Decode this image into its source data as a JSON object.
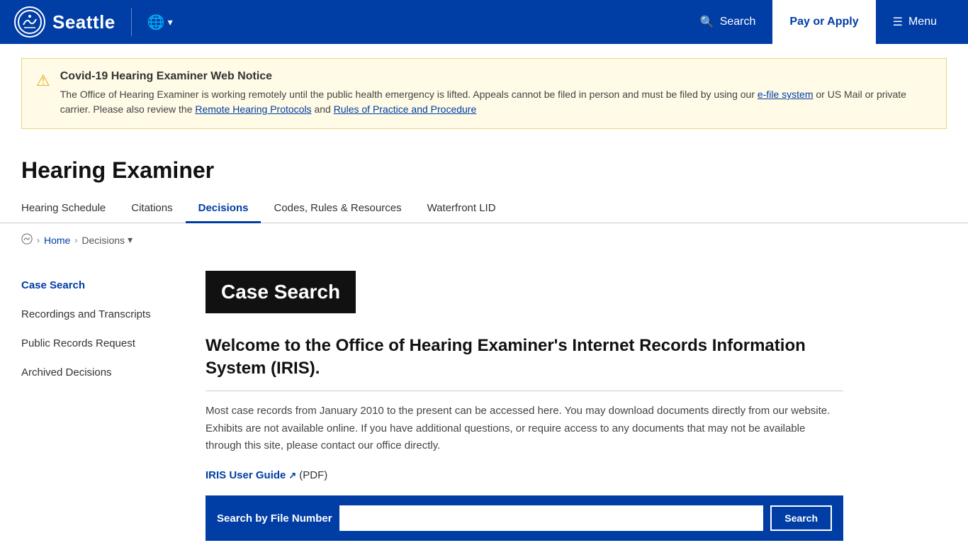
{
  "header": {
    "city": "Seattle",
    "search_label": "Search",
    "pay_apply_label": "Pay or Apply",
    "menu_label": "Menu",
    "translate_label": "Translate"
  },
  "notice": {
    "icon": "⚠",
    "title": "Covid-19 Hearing Examiner Web Notice",
    "text_before_link1": "The Office of Hearing Examiner is working remotely until the public health emergency is lifted. Appeals cannot be filed in person and must be filed by using our ",
    "link1_text": "e-file system",
    "text_between": " or US Mail or private carrier.  Please also review the ",
    "link2_text": "Remote Hearing Protocols",
    "text_and": " and ",
    "link3_text": "Rules of Practice and Procedure"
  },
  "page": {
    "title": "Hearing Examiner",
    "tabs": [
      {
        "label": "Hearing Schedule",
        "active": false
      },
      {
        "label": "Citations",
        "active": false
      },
      {
        "label": "Decisions",
        "active": true
      },
      {
        "label": "Codes, Rules & Resources",
        "active": false
      },
      {
        "label": "Waterfront LID",
        "active": false
      }
    ]
  },
  "breadcrumb": {
    "home": "Home",
    "current": "Decisions"
  },
  "sidebar": {
    "items": [
      {
        "label": "Case Search",
        "active": true
      },
      {
        "label": "Recordings and Transcripts",
        "active": false
      },
      {
        "label": "Public Records Request",
        "active": false
      },
      {
        "label": "Archived Decisions",
        "active": false
      }
    ]
  },
  "content": {
    "case_search_heading": "Case Search",
    "welcome_heading": "Welcome to the Office of Hearing Examiner's Internet Records Information System (IRIS).",
    "body_text": "Most case records from January 2010 to the present can be accessed here. You may download documents directly from our website. Exhibits are not available online. If you have additional questions, or require access to any documents that may not be available through this site, please contact our office directly.",
    "iris_link_label": "IRIS User Guide",
    "iris_link_suffix": " (PDF)",
    "search_form_label": "Search by File Number",
    "search_placeholder": "",
    "search_button": "Search"
  }
}
